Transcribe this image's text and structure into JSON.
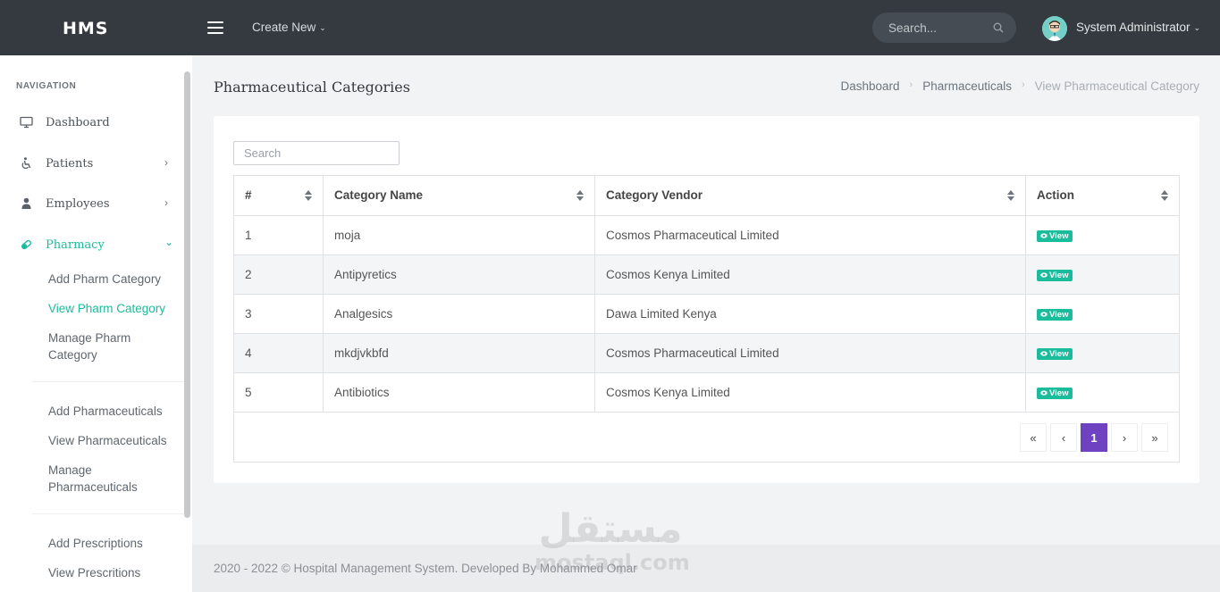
{
  "topbar": {
    "logo": "HMS",
    "create_new": "Create New",
    "search_placeholder": "Search...",
    "user_name": "System Administrator"
  },
  "sidebar": {
    "heading": "NAVIGATION",
    "items": [
      {
        "label": "Dashboard",
        "icon": "monitor-icon"
      },
      {
        "label": "Patients",
        "icon": "wheelchair-icon"
      },
      {
        "label": "Employees",
        "icon": "user-icon"
      },
      {
        "label": "Pharmacy",
        "icon": "pill-icon"
      }
    ],
    "sub_items": [
      "Add Pharm Category",
      "View Pharm Category",
      "Manage Pharm Category",
      "Add Pharmaceuticals",
      "View Pharmaceuticals",
      "Manage Pharmaceuticals",
      "Add Prescriptions",
      "View Prescritions"
    ]
  },
  "page": {
    "title": "Pharmaceutical Categories",
    "breadcrumb": [
      "Dashboard",
      "Pharmaceuticals",
      "View Pharmaceutical Category"
    ]
  },
  "table": {
    "search_placeholder": "Search",
    "columns": [
      "#",
      "Category Name",
      "Category Vendor",
      "Action"
    ],
    "view_label": "View",
    "rows": [
      {
        "num": "1",
        "name": "moja",
        "vendor": "Cosmos Pharmaceutical Limited"
      },
      {
        "num": "2",
        "name": "Antipyretics",
        "vendor": "Cosmos Kenya Limited"
      },
      {
        "num": "3",
        "name": "Analgesics",
        "vendor": "Dawa Limited Kenya"
      },
      {
        "num": "4",
        "name": "mkdjvkbfd",
        "vendor": "Cosmos Pharmaceutical Limited"
      },
      {
        "num": "5",
        "name": "Antibiotics",
        "vendor": "Cosmos Kenya Limited"
      }
    ],
    "pagination": [
      "«",
      "‹",
      "1",
      "›",
      "»"
    ]
  },
  "footer": {
    "text": "2020 - 2022 © Hospital Management System. Developed By Mohammed Omar"
  },
  "watermark": {
    "line1": "مستقل",
    "line2": "mostaql.com"
  },
  "colors": {
    "accent": "#1abc9c",
    "pagination_active": "#6f42c1",
    "topbar": "#343a40"
  }
}
